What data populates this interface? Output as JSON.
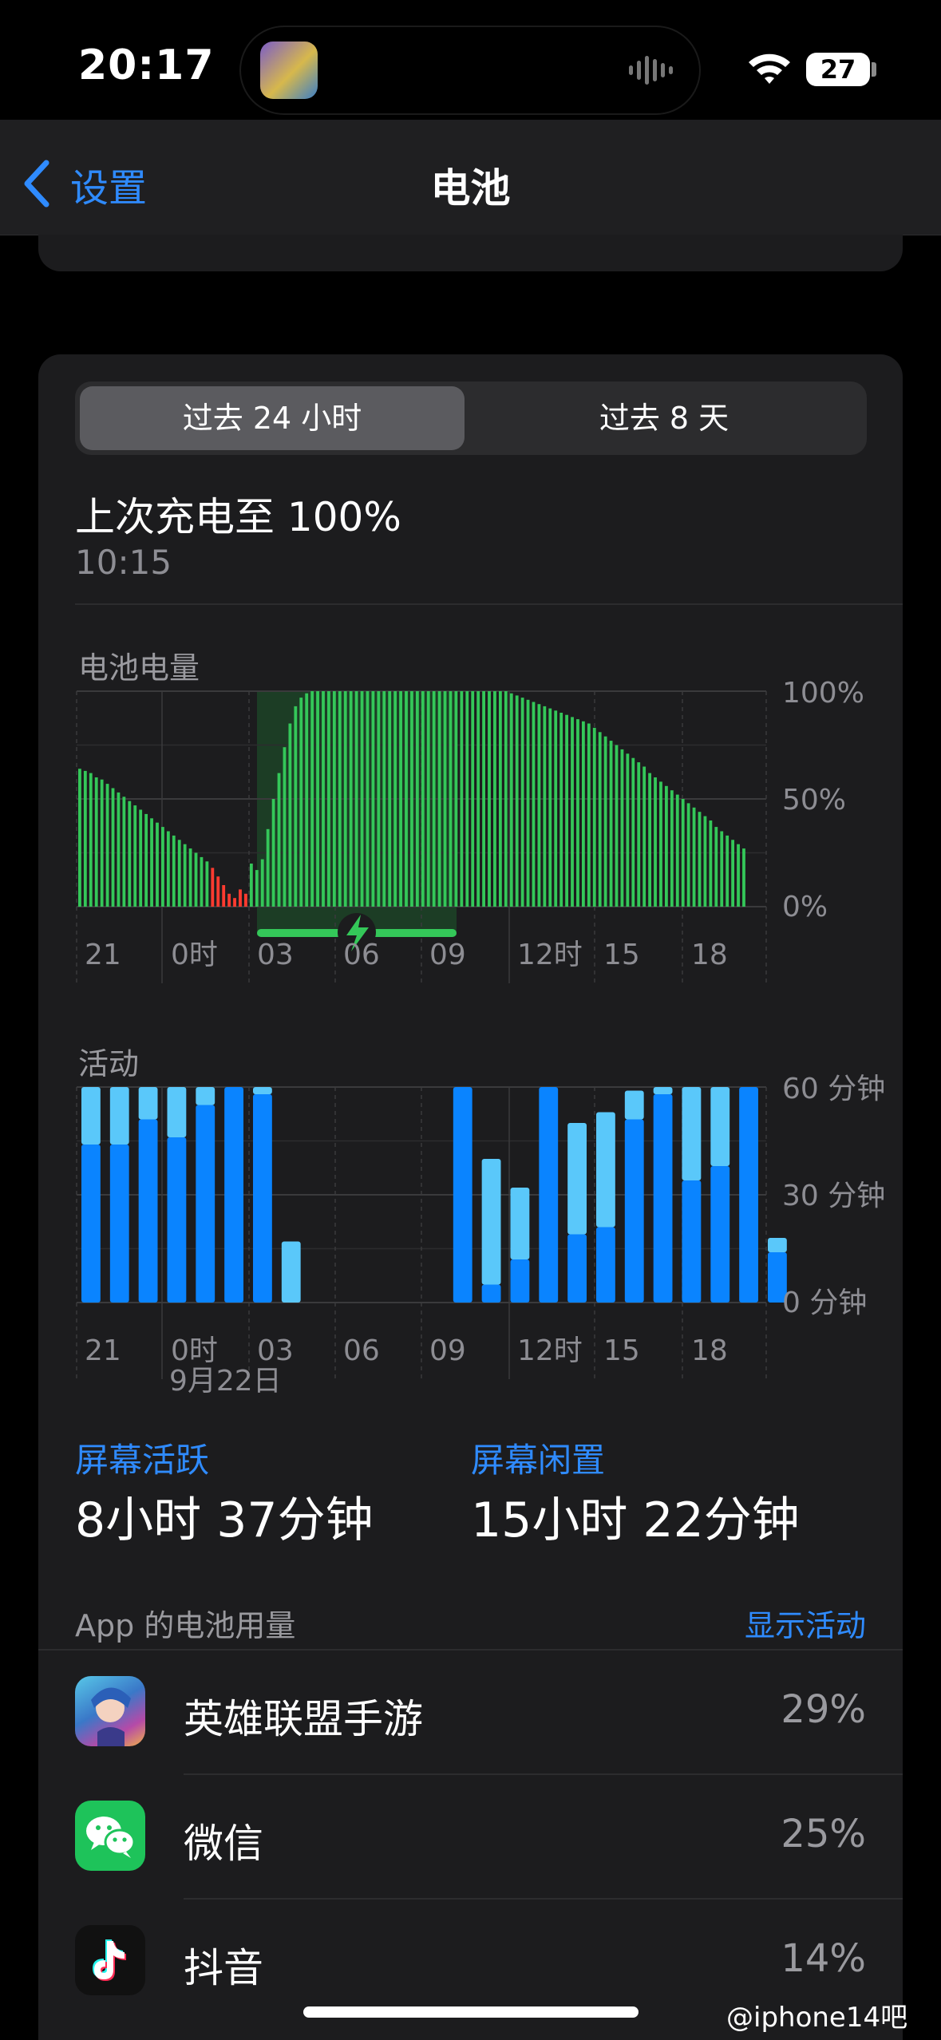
{
  "status_bar": {
    "time": "20:17",
    "battery_level": "27"
  },
  "nav": {
    "back_label": "设置",
    "title": "电池"
  },
  "segmented": {
    "options": [
      "过去 24 小时",
      "过去 8 天"
    ],
    "selected": 0
  },
  "last_charge": {
    "title": "上次充电至 100%",
    "time": "10:15"
  },
  "battery_chart": {
    "label": "电池电量",
    "y_ticks": [
      "100%",
      "50%",
      "0%"
    ],
    "x_ticks": [
      "21",
      "0时",
      "03",
      "06",
      "09",
      "12时",
      "15",
      "18"
    ]
  },
  "activity_chart": {
    "label": "活动",
    "y_ticks": [
      "60 分钟",
      "30 分钟",
      "0 分钟"
    ],
    "x_ticks": [
      "21",
      "0时",
      "03",
      "06",
      "09",
      "12时",
      "15",
      "18"
    ],
    "date_label": "9月22日"
  },
  "chart_data": [
    {
      "type": "bar",
      "title": "电池电量",
      "unit": "%",
      "ylim": [
        0,
        100
      ],
      "y_ticks": [
        "100%",
        "50%",
        "0%"
      ],
      "x_ticks": [
        "21",
        "0时",
        "03",
        "06",
        "09",
        "12时",
        "15",
        "18"
      ],
      "values": [
        64,
        63,
        62,
        60,
        59,
        57,
        55,
        53,
        51,
        49,
        47,
        45,
        43,
        41,
        39,
        37,
        35,
        33,
        31,
        29,
        27,
        25,
        23,
        21,
        18,
        14,
        10,
        6,
        4,
        8,
        6,
        20,
        17,
        22,
        36,
        50,
        62,
        74,
        85,
        93,
        97,
        99,
        100,
        100,
        100,
        100,
        100,
        100,
        100,
        100,
        100,
        100,
        100,
        100,
        100,
        100,
        100,
        100,
        100,
        100,
        100,
        100,
        100,
        100,
        100,
        100,
        100,
        100,
        100,
        100,
        100,
        100,
        100,
        100,
        100,
        100,
        100,
        100,
        99,
        98,
        97,
        96,
        95,
        94,
        93,
        92,
        91,
        90,
        89,
        88,
        87,
        86,
        85,
        83,
        81,
        79,
        77,
        75,
        73,
        71,
        69,
        67,
        65,
        62,
        60,
        58,
        56,
        54,
        52,
        50,
        48,
        46,
        44,
        42,
        40,
        37,
        35,
        33,
        31,
        29,
        27
      ],
      "low_battery_indices": [
        24,
        25,
        26,
        27,
        28,
        29,
        30
      ],
      "charging_window": [
        "02:00",
        "09:00"
      ]
    },
    {
      "type": "bar",
      "title": "活动",
      "unit": "分钟",
      "ylim": [
        0,
        60
      ],
      "y_ticks": [
        "60 分钟",
        "30 分钟",
        "0 分钟"
      ],
      "x_ticks": [
        "21",
        "0时",
        "03",
        "06",
        "09",
        "12时",
        "15",
        "18"
      ],
      "series": [
        {
          "name": "屏幕活跃",
          "values": [
            44,
            44,
            51,
            46,
            55,
            60,
            58,
            0,
            0,
            0,
            0,
            0,
            0,
            60,
            5,
            12,
            60,
            19,
            21,
            51,
            58,
            34,
            38,
            60,
            14
          ]
        },
        {
          "name": "屏幕闲置",
          "values": [
            16,
            16,
            9,
            14,
            5,
            0,
            2,
            17,
            0,
            0,
            0,
            0,
            0,
            0,
            35,
            20,
            0,
            31,
            32,
            8,
            2,
            26,
            22,
            0,
            4
          ]
        }
      ],
      "hour_labels": [
        "21",
        "22",
        "23",
        "00",
        "01",
        "02",
        "03",
        "04",
        "05",
        "06",
        "07",
        "08",
        "09",
        "10",
        "11",
        "12",
        "13",
        "14",
        "15",
        "16",
        "17",
        "18",
        "19",
        "20",
        "21"
      ]
    }
  ],
  "screen_stats": {
    "active_label": "屏幕活跃",
    "active_value": "8小时 37分钟",
    "idle_label": "屏幕闲置",
    "idle_value": "15小时 22分钟"
  },
  "app_usage": {
    "title": "App 的电池用量",
    "toggle_label": "显示活动",
    "apps": [
      {
        "name": "英雄联盟手游",
        "percent": "29%",
        "icon": "lol-game-icon"
      },
      {
        "name": "微信",
        "percent": "25%",
        "icon": "wechat-icon"
      },
      {
        "name": "抖音",
        "percent": "14%",
        "icon": "douyin-icon"
      }
    ]
  },
  "watermark": "@iphone14吧",
  "colors": {
    "accent": "#2f8bff",
    "battery_bar": "#34c759",
    "low_battery": "#ff3b30",
    "active_bar": "#0a84ff",
    "idle_bar": "#5ac8fa",
    "card": "#1c1c1e"
  }
}
